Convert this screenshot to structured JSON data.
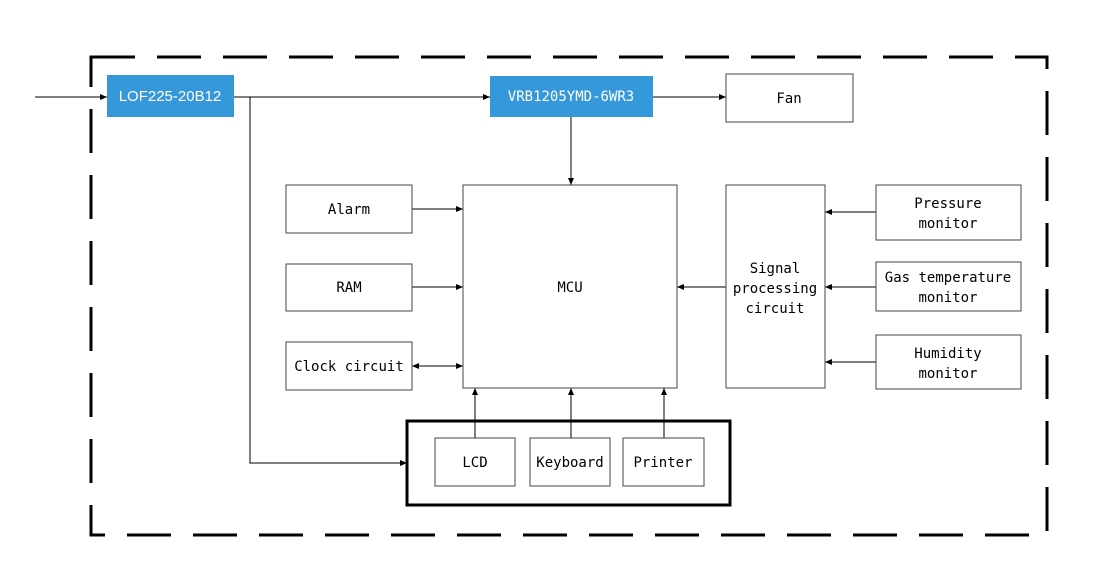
{
  "colors": {
    "module_fill": "#3598db",
    "module_text": "#ffffff",
    "line": "#000000"
  },
  "modules": {
    "power_filter": "LOF225-20B12",
    "dc_converter": "VRB1205YMD-6WR3"
  },
  "blocks": {
    "fan": "Fan",
    "alarm": "Alarm",
    "ram": "RAM",
    "clock": "Clock circuit",
    "mcu": "MCU",
    "signal": [
      "Signal",
      "processing",
      "circuit"
    ],
    "pressure": [
      "Pressure",
      "monitor"
    ],
    "gas": [
      "Gas temperature",
      "monitor"
    ],
    "humidity": [
      "Humidity",
      "monitor"
    ],
    "lcd": "LCD",
    "keyboard": "Keyboard",
    "printer": "Printer"
  }
}
